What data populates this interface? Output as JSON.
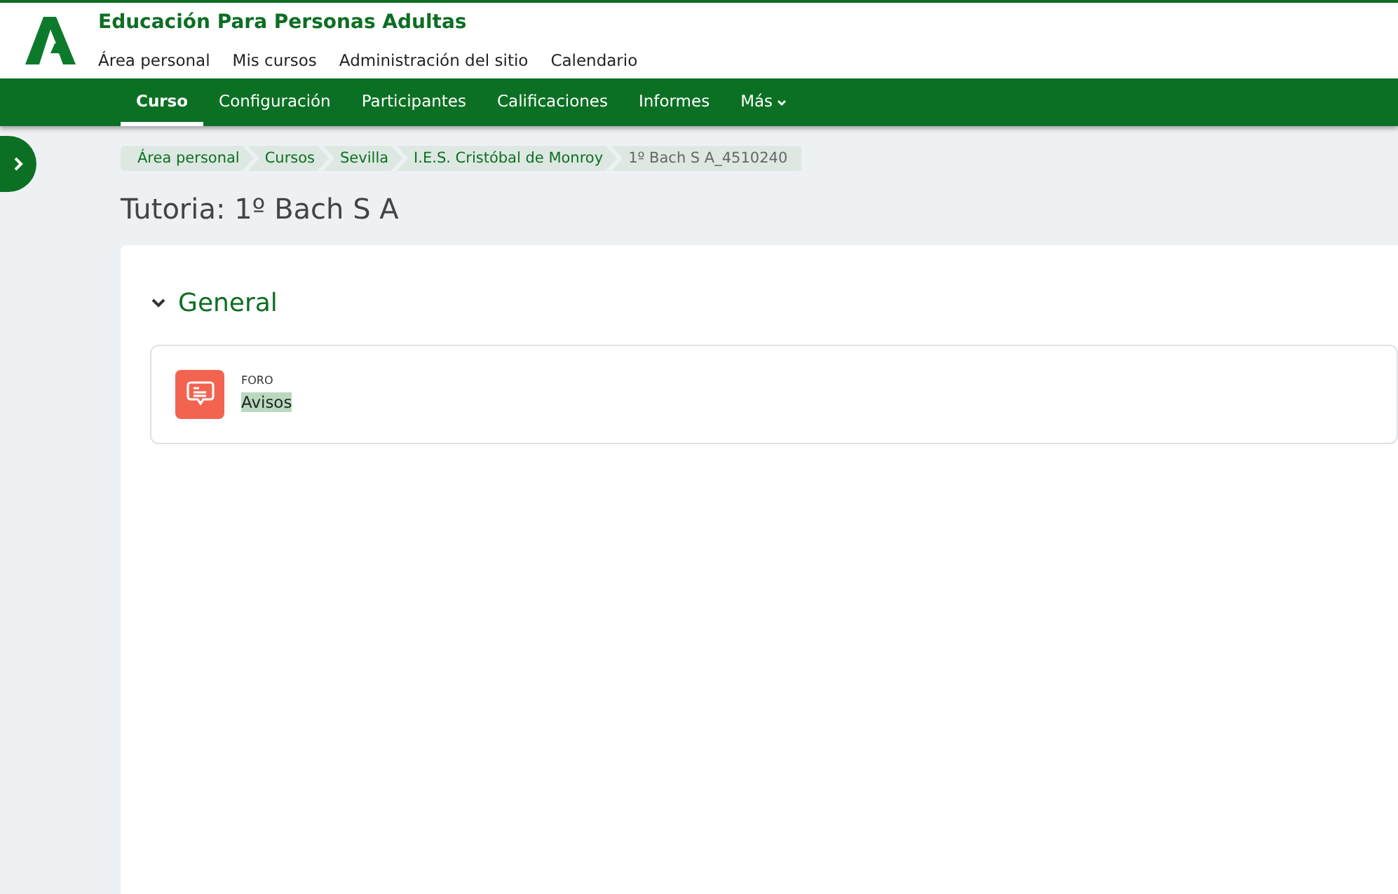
{
  "site": {
    "title": "Educación Para Personas Adultas",
    "links": [
      "Área personal",
      "Mis cursos",
      "Administración del sitio",
      "Calendario"
    ]
  },
  "course_nav": [
    {
      "label": "Curso",
      "selected": true
    },
    {
      "label": "Configuración",
      "selected": false
    },
    {
      "label": "Participantes",
      "selected": false
    },
    {
      "label": "Calificaciones",
      "selected": false
    },
    {
      "label": "Informes",
      "selected": false
    },
    {
      "label": "Más",
      "selected": false,
      "kind": "dropdown"
    }
  ],
  "drawer": {
    "expanded": false
  },
  "breadcrumb": [
    {
      "label": "Área personal",
      "current": false
    },
    {
      "label": "Cursos",
      "current": false
    },
    {
      "label": "Sevilla",
      "current": false
    },
    {
      "label": "I.E.S. Cristóbal de Monroy",
      "current": false
    },
    {
      "label": "1º Bach S A_4510240",
      "current": true
    }
  ],
  "page_title": "Tutoria: 1º Bach S A",
  "sections": [
    {
      "title": "General",
      "expanded": true,
      "activities": [
        {
          "type": "FORO",
          "name": "Avisos",
          "highlighted": true
        }
      ]
    }
  ]
}
